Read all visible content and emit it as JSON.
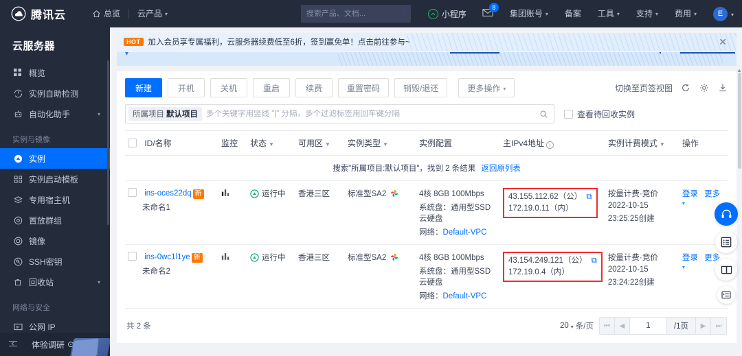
{
  "topnav": {
    "brand": "腾讯云",
    "links": [
      {
        "label": "总览",
        "icon": "home-icon"
      },
      {
        "label": "云产品",
        "icon": "chevron-down-icon"
      }
    ],
    "search_placeholder": "搜索产品、文档...",
    "mini_app": "小程序",
    "mail_badge": "8",
    "items": [
      {
        "label": "集团账号",
        "caret": true
      },
      {
        "label": "备案",
        "caret": false
      },
      {
        "label": "工具",
        "caret": true
      },
      {
        "label": "支持",
        "caret": true
      },
      {
        "label": "费用",
        "caret": true
      }
    ],
    "avatar_letter": "E"
  },
  "sidebar": {
    "title": "云服务器",
    "items": [
      {
        "label": "概览",
        "icon": "dashboard-icon",
        "active": false,
        "chevron": false
      },
      {
        "label": "实例自助检测",
        "icon": "detect-icon",
        "active": false,
        "chevron": false
      },
      {
        "label": "自动化助手",
        "icon": "robot-icon",
        "active": false,
        "chevron": true
      }
    ],
    "group1": "实例与镜像",
    "items2": [
      {
        "label": "实例",
        "icon": "instance-icon",
        "active": true,
        "chevron": false
      },
      {
        "label": "实例启动模板",
        "icon": "template-icon",
        "active": false,
        "chevron": false
      },
      {
        "label": "专用宿主机",
        "icon": "host-icon",
        "active": false,
        "chevron": false
      },
      {
        "label": "置放群组",
        "icon": "group-icon",
        "active": false,
        "chevron": false
      },
      {
        "label": "镜像",
        "icon": "image-icon",
        "active": false,
        "chevron": false
      },
      {
        "label": "SSH密钥",
        "icon": "key-icon",
        "active": false,
        "chevron": false
      },
      {
        "label": "回收站",
        "icon": "trash-icon",
        "active": false,
        "chevron": true
      }
    ],
    "group2": "网络与安全",
    "items3": [
      {
        "label": "公网 IP",
        "icon": "ip-icon",
        "active": false,
        "chevron": false
      }
    ],
    "bottom_label": "体验调研"
  },
  "banner": {
    "tag": "HOT",
    "text": "加入会员享专属福利，云服务器续费低至6折，签到赢免单！点击前往参与~",
    "close": "✕"
  },
  "toolbar": {
    "buttons": [
      {
        "label": "新建",
        "primary": true
      },
      {
        "label": "开机",
        "primary": false
      },
      {
        "label": "关机",
        "primary": false
      },
      {
        "label": "重启",
        "primary": false
      },
      {
        "label": "续费",
        "primary": false
      },
      {
        "label": "重置密码",
        "primary": false
      },
      {
        "label": "销毁/退还",
        "primary": false
      }
    ],
    "more_label": "更多操作",
    "switch_view": "切换至页签视图"
  },
  "filter": {
    "chip_label": "所属项目",
    "chip_value": "默认项目",
    "placeholder": "多个关键字用竖线 \"|\" 分隔，多个过滤标签用回车键分隔",
    "checkbox_label": "查看待回收实例"
  },
  "table": {
    "headers": [
      {
        "label": "ID/名称",
        "sort": false,
        "info": false
      },
      {
        "label": "监控",
        "sort": false,
        "info": false
      },
      {
        "label": "状态",
        "sort": true,
        "info": false
      },
      {
        "label": "可用区",
        "sort": true,
        "info": false
      },
      {
        "label": "实例类型",
        "sort": true,
        "info": false
      },
      {
        "label": "实例配置",
        "sort": false,
        "info": false
      },
      {
        "label": "主IPv4地址",
        "sort": false,
        "info": true
      },
      {
        "label": "实例计费模式",
        "sort": true,
        "info": false
      },
      {
        "label": "操作",
        "sort": false,
        "info": false
      }
    ],
    "search_result_prefix": "搜索",
    "search_result_query": "\"所属项目:默认项目\"",
    "search_result_mid": "，找到 2 条结果",
    "search_result_link": "返回原列表",
    "rows": [
      {
        "id": "ins-oces22dq",
        "badge": "新",
        "name": "未命名1",
        "status": "运行中",
        "zone": "香港三区",
        "type": "标准型SA2",
        "config_line1": "4核 8GB 100Mbps",
        "config_line2": "系统盘：通用型SSD云硬盘",
        "config_line3_label": "网络：",
        "config_line3_value": "Default-VPC",
        "ip_public": "43.155.112.62（公）",
        "ip_private": "172.19.0.11（内）",
        "billing_mode": "按量计费·竞价",
        "billing_date": "2022-10-15",
        "billing_time": "23:25:25创建",
        "action_login": "登录",
        "action_more": "更多"
      },
      {
        "id": "ins-0wc1l1ye",
        "badge": "新",
        "name": "未命名2",
        "status": "运行中",
        "zone": "香港三区",
        "type": "标准型SA2",
        "config_line1": "4核 8GB 100Mbps",
        "config_line2": "系统盘：通用型SSD云硬盘",
        "config_line3_label": "网络：",
        "config_line3_value": "Default-VPC",
        "ip_public": "43.154.249.121（公）",
        "ip_private": "172.19.0.4（内）",
        "billing_mode": "按量计费·竞价",
        "billing_date": "2022-10-15",
        "billing_time": "23:24:22创建",
        "action_login": "登录",
        "action_more": "更多"
      }
    ]
  },
  "pager": {
    "total": "共 2 条",
    "page_size": "20",
    "page_size_unit": "条/页",
    "current_page": "1",
    "total_pages": "/1页"
  },
  "rail": {
    "items": [
      {
        "icon": "headset-icon",
        "style": "blue"
      },
      {
        "icon": "list-icon",
        "style": "white"
      },
      {
        "icon": "book-icon",
        "style": "white"
      },
      {
        "icon": "menu-list-icon",
        "style": "white-small"
      }
    ]
  },
  "colors": {
    "brand_blue": "#006eff",
    "nav_dark": "#242c3c",
    "hot_orange": "#ff7800",
    "highlight_red": "#f22c2c"
  }
}
